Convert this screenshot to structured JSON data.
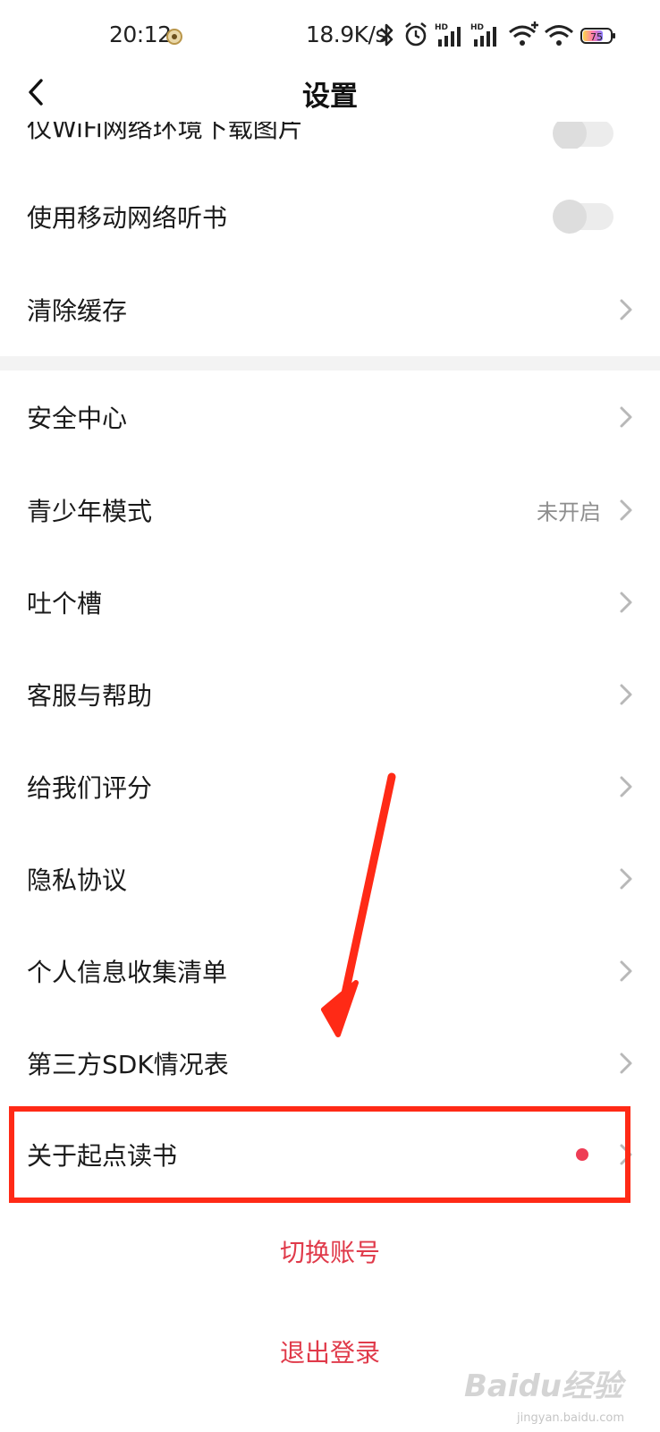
{
  "status_bar": {
    "time": "20:12",
    "speed": "18.9K/s",
    "battery": "75",
    "icons": [
      "bluetooth-icon",
      "alarm-icon",
      "hd-signal-icon",
      "hd-signal-icon",
      "wifi-plus-icon",
      "wifi-icon",
      "battery-icon"
    ]
  },
  "nav": {
    "title": "设置",
    "back_icon": "chevron-left-icon"
  },
  "partial_row": {
    "label": "仅WiFi网络环境下载图片"
  },
  "rows": [
    {
      "label": "使用移动网络听书",
      "control": "toggle",
      "toggle_on": false
    },
    {
      "label": "清除缓存",
      "control": "chevron"
    },
    {
      "label": "安全中心",
      "control": "chevron"
    },
    {
      "label": "青少年模式",
      "value": "未开启",
      "control": "chevron"
    },
    {
      "label": "吐个槽",
      "control": "chevron"
    },
    {
      "label": "客服与帮助",
      "control": "chevron"
    },
    {
      "label": "给我们评分",
      "control": "chevron"
    },
    {
      "label": "隐私协议",
      "control": "chevron"
    },
    {
      "label": "个人信息收集清单",
      "control": "chevron"
    },
    {
      "label": "第三方SDK情况表",
      "control": "chevron"
    },
    {
      "label": "关于起点读书",
      "control": "chevron",
      "badge_dot": true
    }
  ],
  "actions": {
    "switch_account": "切换账号",
    "logout": "退出登录"
  },
  "watermark": {
    "brand": "Baidu经验",
    "url": "jingyan.baidu.com"
  },
  "colors": {
    "accent_red": "#e03a4a",
    "annotation_red": "#ff2a16",
    "badge_dot": "#ee3d55",
    "section_gap": "#f3f3f3"
  }
}
